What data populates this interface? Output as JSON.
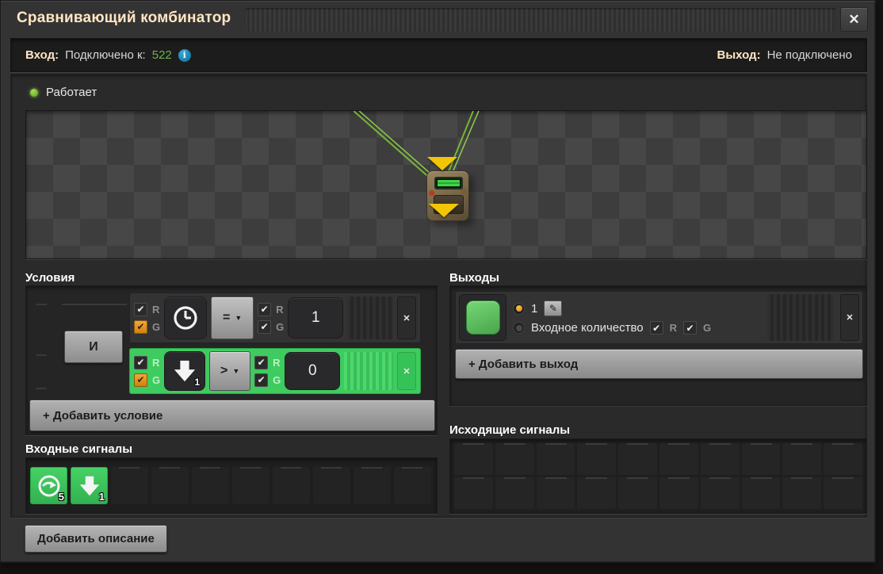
{
  "window": {
    "title": "Сравнивающий комбинатор"
  },
  "icons": {
    "close": "✕",
    "check": "✔",
    "caret": "▼",
    "info": "i",
    "edit": "✎"
  },
  "labels": {
    "r": "R",
    "g": "G"
  },
  "connection": {
    "input_label": "Вход:",
    "input_text": "Подключено к:",
    "input_value": "522",
    "output_label": "Выход:",
    "output_text": "Не подключено"
  },
  "status": {
    "text": "Работает"
  },
  "conditions": {
    "title": "Условия",
    "and": "И",
    "add": "+ Добавить условие",
    "rows": [
      {
        "signal": "clock-signal",
        "comparator": "=",
        "value": "1"
      },
      {
        "signal": "down-arrow-signal",
        "signal_count": "1",
        "comparator": ">",
        "value": "0"
      }
    ]
  },
  "outputs": {
    "title": "Выходы",
    "add": "+ Добавить выход",
    "signal": "green-color-signal",
    "value_option": "1",
    "input_count_option": "Входное количество"
  },
  "input_signals": {
    "title": "Входные сигналы",
    "slots": [
      {
        "icon": "loop-arrow-signal",
        "count": "5"
      },
      {
        "icon": "down-arrow-signal",
        "count": "1"
      }
    ]
  },
  "outgoing_signals": {
    "title": "Исходящие сигналы"
  },
  "footer": {
    "add_description": "Добавить описание"
  },
  "colors": {
    "accent_green": "#3ecb5f",
    "signal_green": "#5ec95e",
    "checkbox_orange": "#e0921f",
    "title_cream": "#ffe7c3",
    "connected_green": "#6cb14c",
    "wire_green": "#74b733",
    "arrow_yellow": "#f2c506"
  }
}
